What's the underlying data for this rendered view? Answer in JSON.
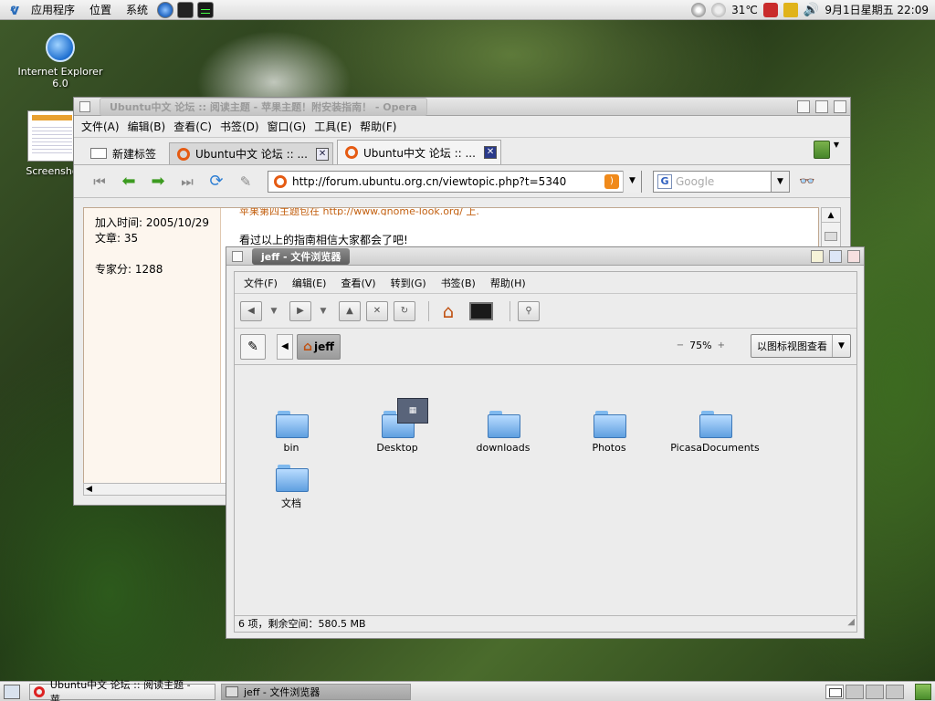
{
  "top_panel": {
    "menus": [
      "应用程序",
      "位置",
      "系统"
    ],
    "temperature": "31℃",
    "clock": "9月1日星期五 22:09"
  },
  "desktop_icons": [
    {
      "label": "Internet Explorer 6.0",
      "icon": "ie-icon"
    },
    {
      "label": "Screensho",
      "icon": "screenshot-thumbnail-icon"
    }
  ],
  "opera": {
    "title": "Ubuntu中文 论坛 :: 阅读主题 - 苹果主题！附安装指南！ - Opera",
    "menu": [
      "文件(A)",
      "编辑(B)",
      "查看(C)",
      "书签(D)",
      "窗口(G)",
      "工具(E)",
      "帮助(F)"
    ],
    "new_tab_label": "新建标签",
    "tabs": [
      {
        "label": "Ubuntu中文 论坛 :: ...",
        "active": false
      },
      {
        "label": "Ubuntu中文 论坛 :: ...",
        "active": true
      }
    ],
    "url": "http://forum.ubuntu.org.cn/viewtopic.php?t=5340",
    "search_placeholder": "Google",
    "profile": {
      "join_date": "加入时间: 2005/10/29",
      "posts": "文章: 35",
      "expert_score": "专家分: 1288"
    },
    "post": {
      "cut_line": "苹果第四主题包在 http://www.gnome-look.org/ 上.",
      "line2": "看过以上的指南相信大家都会了吧!"
    }
  },
  "nautilus": {
    "title": "jeff - 文件浏览器",
    "menu": [
      "文件(F)",
      "编辑(E)",
      "查看(V)",
      "转到(G)",
      "书签(B)",
      "帮助(H)"
    ],
    "path_button": "jeff",
    "zoom_level": "75%",
    "view_mode": "以图标视图查看",
    "files": [
      {
        "name": "bin"
      },
      {
        "name": "Desktop"
      },
      {
        "name": "downloads"
      },
      {
        "name": "Photos"
      },
      {
        "name": "PicasaDocuments"
      },
      {
        "name": "文档"
      }
    ],
    "status": "6 项，剩余空间：580.5 MB"
  },
  "taskbar": {
    "tasks": [
      {
        "label": "Ubuntu中文 论坛 :: 阅读主题 - 苹...",
        "active": false
      },
      {
        "label": "jeff - 文件浏览器",
        "active": true
      }
    ]
  }
}
